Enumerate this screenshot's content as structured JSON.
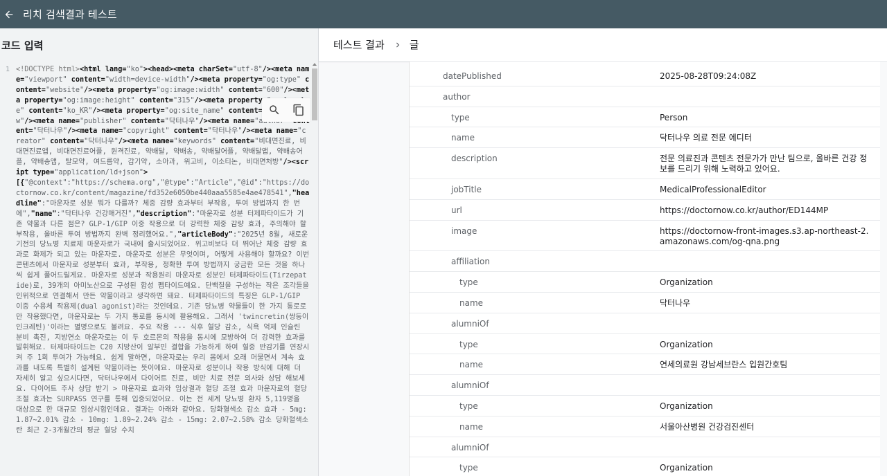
{
  "topbar": {
    "title": "리치 검색결과 테스트"
  },
  "left_panel": {
    "title": "코드 입력",
    "line_number": "1"
  },
  "code": {
    "segments": [
      {
        "t": "<!DOCTYPE html>",
        "c": "cmt"
      },
      {
        "t": "<html lang=",
        "c": "kw"
      },
      {
        "t": "\"ko\"",
        "c": "str"
      },
      {
        "t": "><head><meta charSet=",
        "c": "kw"
      },
      {
        "t": "\"utf-8\"",
        "c": "str"
      },
      {
        "t": "/><meta ",
        "c": "kw"
      },
      {
        "t": "name=",
        "c": "kw"
      },
      {
        "t": "\"viewport\" ",
        "c": "str"
      },
      {
        "t": "content=",
        "c": "kw"
      },
      {
        "t": "\"width=device-width\"",
        "c": "str"
      },
      {
        "t": "/><meta property=",
        "c": "kw"
      },
      {
        "t": "\"og:type\" ",
        "c": "str"
      },
      {
        "t": "content=",
        "c": "kw"
      },
      {
        "t": "\"website\"",
        "c": "str"
      },
      {
        "t": "/><meta property=",
        "c": "kw"
      },
      {
        "t": "\"og:image:width\" ",
        "c": "str"
      },
      {
        "t": "content=",
        "c": "kw"
      },
      {
        "t": "\"600\"",
        "c": "str"
      },
      {
        "t": "/><meta property=",
        "c": "kw"
      },
      {
        "t": "\"og:image:height\" ",
        "c": "str"
      },
      {
        "t": "content=",
        "c": "kw"
      },
      {
        "t": "\"315\"",
        "c": "str"
      },
      {
        "t": "/><meta property=",
        "c": "kw"
      },
      {
        "t": "\"og:locale\" ",
        "c": "str"
      },
      {
        "t": "content=",
        "c": "kw"
      },
      {
        "t": "\"ko_KR\"",
        "c": "str"
      },
      {
        "t": "/><meta property=",
        "c": "kw"
      },
      {
        "t": "\"og:site_name\" ",
        "c": "str"
      },
      {
        "t": "content=",
        "c": "kw"
      },
      {
        "t": "\"doctornow\"",
        "c": "str"
      },
      {
        "t": "/><meta name=",
        "c": "kw"
      },
      {
        "t": "\"publisher\" ",
        "c": "str"
      },
      {
        "t": "content=",
        "c": "kw"
      },
      {
        "t": "\"닥터나우\"",
        "c": "str"
      },
      {
        "t": "/><meta name=",
        "c": "kw"
      },
      {
        "t": "\"author\" ",
        "c": "str"
      },
      {
        "t": "content=",
        "c": "kw"
      },
      {
        "t": "\"닥터나우\"",
        "c": "str"
      },
      {
        "t": "/><meta name=",
        "c": "kw"
      },
      {
        "t": "\"copyright\" ",
        "c": "str"
      },
      {
        "t": "content=",
        "c": "kw"
      },
      {
        "t": "\"닥터나우\"",
        "c": "str"
      },
      {
        "t": "/><meta name=",
        "c": "kw"
      },
      {
        "t": "\"creator\" ",
        "c": "str"
      },
      {
        "t": "content=",
        "c": "kw"
      },
      {
        "t": "\"닥터나우\"",
        "c": "str"
      },
      {
        "t": "/><meta name=",
        "c": "kw"
      },
      {
        "t": "\"keywords\" ",
        "c": "str"
      },
      {
        "t": "content=",
        "c": "kw"
      },
      {
        "t": "\"비대면진료, 비대면진료앱, 비대면진료어플, 원격진료, 약배달, 약배송, 약배달어플, 약배달앱, 약배송어플, 약배송앱, 탈모약, 여드름약, 감기약, 소아과, 위고비, 이소티논, 비대면처방\"",
        "c": "str"
      },
      {
        "t": "/><script type=",
        "c": "kw"
      },
      {
        "t": "\"application/ld+json\"",
        "c": "str"
      },
      {
        "t": ">\n[{",
        "c": "kw"
      },
      {
        "t": "\"@context\":\"https://schema.org\",\"@type\":\"Article\",\"@id\":\"https://doctornow.co.kr/content/magazine/fd352e6050be440aaa5585e4ae478541\",",
        "c": "str"
      },
      {
        "t": "\"headline\"",
        "c": "key"
      },
      {
        "t": ":\"마운자로 성분 뭐가 다를까? 체중 감량 효과부터 부작용, 투여 방법까지 한 번에\",",
        "c": "str"
      },
      {
        "t": "\"name\"",
        "c": "key"
      },
      {
        "t": ":\"닥터나우 건강매거진\",",
        "c": "str"
      },
      {
        "t": "\"description\"",
        "c": "key"
      },
      {
        "t": ":\"마운자로 성분 터제파타이드가 기존 약물과 다른 점은? GLP-1/GIP 이중 작용으로 더 강력한 체중 감량 효과, 주의해야 할 부작용, 올바른 투여 방법까지 완벽 정리했어요.\",",
        "c": "str"
      },
      {
        "t": "\"articleBody\"",
        "c": "key"
      },
      {
        "t": ":\"2025년 8월, 새로운 기전의 당뇨병 치료제 마운자로가 국내에 출시되었어요. 위고비보다 더 뛰어난 체중 감량 효과로 화제가 되고 있는 마운자로. 마운자로 성분은 무엇이며, 어떻게 사용해야 할까요? 이번 콘텐츠에서 마운자로 성분부터 효과, 부작용, 정확한 투여 방법까지 궁금한 모든 것을 하나씩 쉽게 풀어드릴게요. 마운자로 성분과 작용원리 마운자로 성분인 터제파타이드(Tirzepatide)로, 39개의 아미노산으로 구성된 합성 펩타이드예요. 단백질을 구성하는 작은 조각들을 인위적으로 연결해서 만든 약물이라고 생각하면 돼요. 터제파타이드의 특징은 GLP-1/GIP 이중 수용체 작용제(dual agonist)라는 것인데요. 기존 당뇨병 약물들이 한 가지 통로로만 작용했다면, 마운자로는 두 가지 통로를 동시에 활용해요. 그래서 'twincretin(쌍둥이 인크레틴)'이라는 별명으로도 불려요. 주요 작용 --- 식후 혈당 감소, 식욕 억제 인슐린 분비 촉진, 지방연소 마운자로는 이 두 호르몬의 작용을 동시에 모방하여 더 강력한 효과를 발휘해요. 터제파타이드는 C20 지방산이 알부민 결합을 가능하게 하여 혈중 반감기를 연장시켜 주 1회 투여가 가능해요. 쉽게 말하면, 마운자로는 우리 몸에서 오래 머물면서 계속 효과를 내도록 특별히 설계된 약물이라는 뜻이에요. 마운자로 성분이나 작용 방식에 대해 더 자세히 알고 싶으시다면, 닥터나우에서 다이어트 진료, 비만 치료 전문 의사와 상담 해보세요. 다이어트 주사 상담 받기 > 마운자로 효과와 임상결과 혈당 조절 효과 마운자로의 혈당 조절 효과는 SURPASS 연구를 통해 입증되었어요. 이는 전 세계 당뇨병 환자 5,119명을 대상으로 한 대규모 임상시험인데요. 결과는 아래와 같아요. 당화혈색소 감소 효과 - 5mg: 1.87~2.01% 감소 - 10mg: 1.89~2.24% 감소 - 15mg: 2.07~2.58% 감소 당화혈색소란 최근 2-3개월간의 평균 혈당 수치",
        "c": "str"
      }
    ]
  },
  "right_panel": {
    "breadcrumb_root": "테스트 결과",
    "breadcrumb_current": "글"
  },
  "rows": [
    {
      "level": 0,
      "key": "datePublished",
      "value": "2025-08-28T09:24:08Z",
      "h": 30
    },
    {
      "level": 0,
      "key": "author",
      "value": "",
      "h": 30
    },
    {
      "level": 1,
      "key": "type",
      "value": "Person",
      "h": 30
    },
    {
      "level": 1,
      "key": "name",
      "value": "닥터나우 의료 전문 에디터",
      "h": 30
    },
    {
      "level": 1,
      "key": "description",
      "value": "전문 의료진과 콘텐츠 전문가가 만난 팀으로, 올바른 건강 정보를 드리기 위해 노력하고 있어요.",
      "h": 45
    },
    {
      "level": 1,
      "key": "jobTitle",
      "value": "MedicalProfessionalEditor",
      "h": 30
    },
    {
      "level": 1,
      "key": "url",
      "value": "https://doctornow.co.kr/author/ED144MP",
      "h": 30
    },
    {
      "level": 1,
      "key": "image",
      "value": "https://doctornow-front-images.s3.ap-northeast-2.amazonaws.com/og-qna.png",
      "h": 45
    },
    {
      "level": 1,
      "key": "affiliation",
      "value": "",
      "h": 30
    },
    {
      "level": 2,
      "key": "type",
      "value": "Organization",
      "h": 30
    },
    {
      "level": 2,
      "key": "name",
      "value": "닥터나우",
      "h": 30
    },
    {
      "level": 1,
      "key": "alumniOf",
      "value": "",
      "h": 30
    },
    {
      "level": 2,
      "key": "type",
      "value": "Organization",
      "h": 30
    },
    {
      "level": 2,
      "key": "name",
      "value": "연세의료원 강남세브란스 입원간호팀",
      "h": 30
    },
    {
      "level": 1,
      "key": "alumniOf",
      "value": "",
      "h": 30
    },
    {
      "level": 2,
      "key": "type",
      "value": "Organization",
      "h": 30
    },
    {
      "level": 2,
      "key": "name",
      "value": "서울아산병원 건강검진센터",
      "h": 30
    },
    {
      "level": 1,
      "key": "alumniOf",
      "value": "",
      "h": 30
    },
    {
      "level": 2,
      "key": "type",
      "value": "Organization",
      "h": 30
    }
  ],
  "icons": {
    "back": "arrow-left-icon",
    "search": "search-icon",
    "copy": "copy-icon",
    "breadcrumb_sep": "chevron-right-icon"
  },
  "colors": {
    "topbar": "#455a64",
    "left_bg": "#f1f3f4",
    "right_bg": "#f8f9fa"
  }
}
